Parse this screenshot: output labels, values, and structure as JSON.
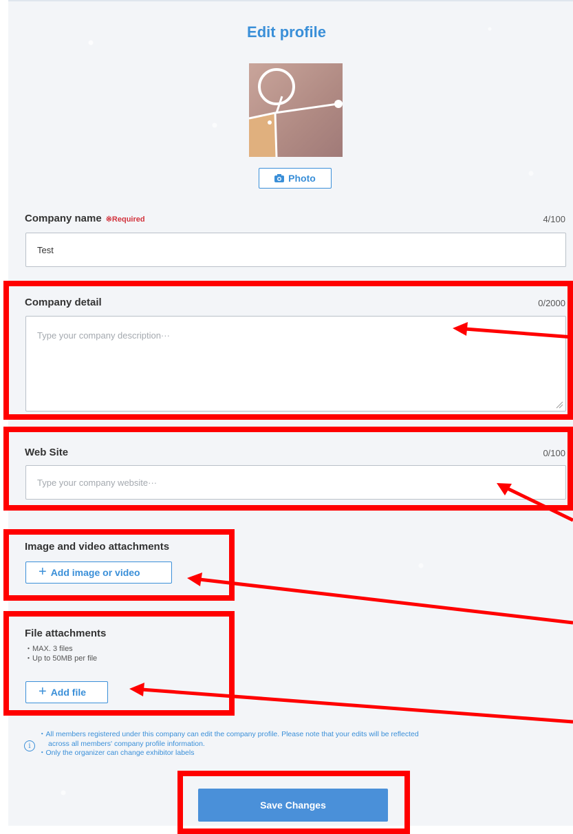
{
  "page": {
    "title": "Edit profile"
  },
  "avatar": {
    "photo_button_label": "Photo",
    "photo_icon": "camera-icon"
  },
  "company_name": {
    "label": "Company name",
    "required": "※Required",
    "counter": "4/100",
    "value": "Test"
  },
  "company_detail": {
    "label": "Company detail",
    "counter": "0/2000",
    "placeholder": "Type your company description···"
  },
  "website": {
    "label": "Web Site",
    "counter": "0/100",
    "placeholder": "Type your company website···"
  },
  "media": {
    "label": "Image and video attachments",
    "button_label": "Add image or video"
  },
  "files": {
    "label": "File attachments",
    "notes": [
      "・MAX. 3 files",
      "・Up to 50MB per file"
    ],
    "button_label": "Add file"
  },
  "info": {
    "icon": "info-icon",
    "lines": [
      "・All members registered under this company can edit the company profile. Please note that your edits will be reflected",
      "across all members' company profile information.",
      "・Only the organizer can change exhibitor labels"
    ]
  },
  "save_button_label": "Save Changes",
  "annotation_color": "#ff0000",
  "accent_color": "#3a8fd8"
}
